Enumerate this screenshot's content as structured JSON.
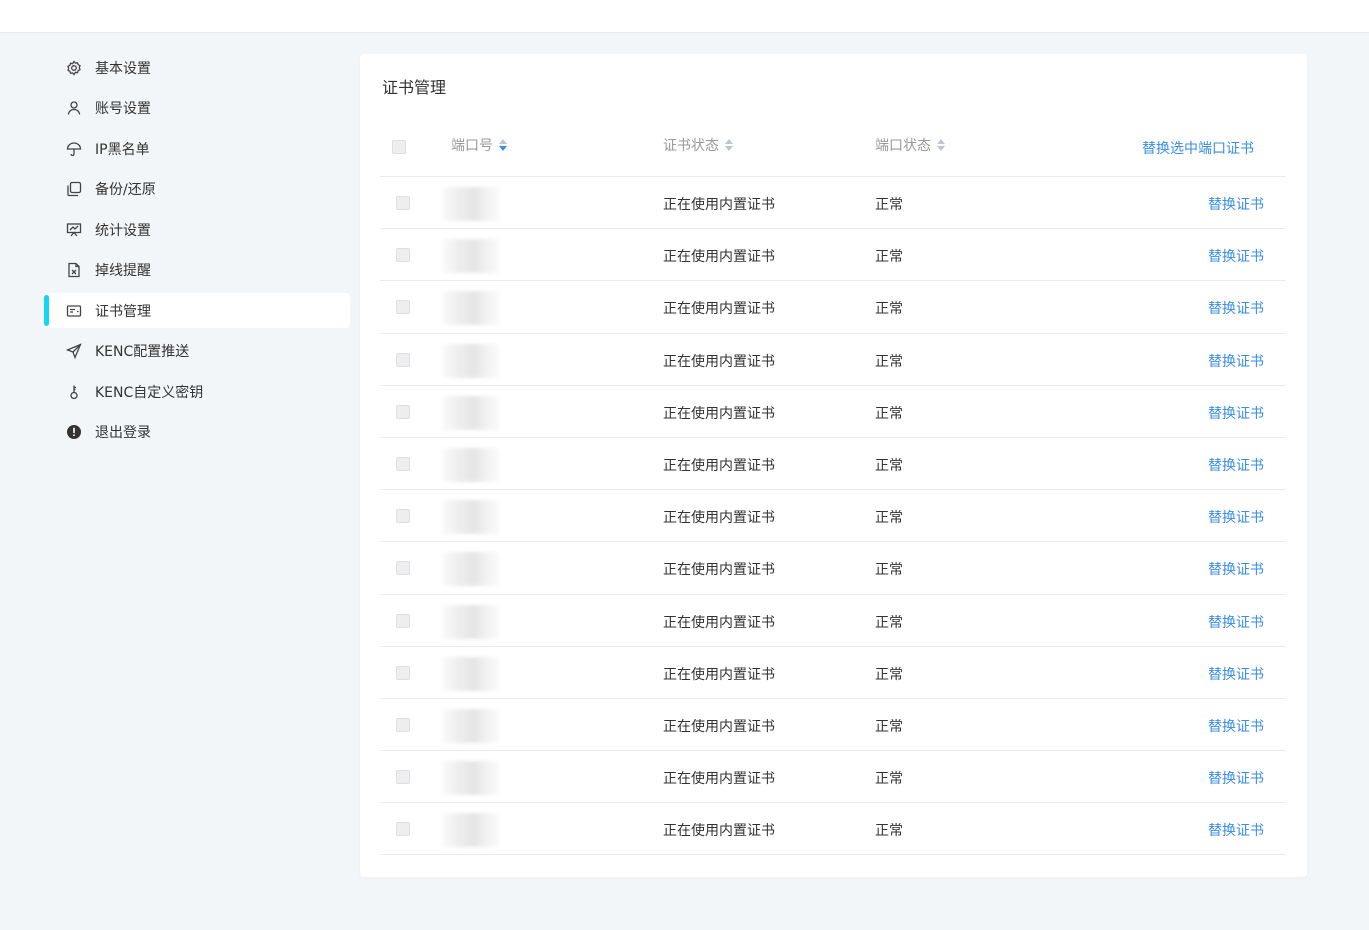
{
  "sidebar": {
    "items": [
      {
        "label": "基本设置",
        "icon": "gear-icon",
        "active": false
      },
      {
        "label": "账号设置",
        "icon": "user-icon",
        "active": false
      },
      {
        "label": "IP黑名单",
        "icon": "umbrella-icon",
        "active": false
      },
      {
        "label": "备份/还原",
        "icon": "copy-icon",
        "active": false
      },
      {
        "label": "统计设置",
        "icon": "presentation-chart-icon",
        "active": false
      },
      {
        "label": "掉线提醒",
        "icon": "file-x-icon",
        "active": false
      },
      {
        "label": "证书管理",
        "icon": "certificate-card-icon",
        "active": true
      },
      {
        "label": "KENC配置推送",
        "icon": "send-icon",
        "active": false
      },
      {
        "label": "KENC自定义密钥",
        "icon": "key-icon",
        "active": false
      },
      {
        "label": "退出登录",
        "icon": "exclamation-circle-icon",
        "active": false
      }
    ],
    "accent_color": "#14d6f0"
  },
  "panel": {
    "title": "证书管理",
    "columns": {
      "port": "端口号",
      "cert_status": "证书状态",
      "port_status": "端口状态"
    },
    "bulk_action": "替换选中端口证书",
    "link_color": "#3a8ee6",
    "rows": [
      {
        "cert_status": "正在使用内置证书",
        "port_status": "正常",
        "action": "替换证书"
      },
      {
        "cert_status": "正在使用内置证书",
        "port_status": "正常",
        "action": "替换证书"
      },
      {
        "cert_status": "正在使用内置证书",
        "port_status": "正常",
        "action": "替换证书"
      },
      {
        "cert_status": "正在使用内置证书",
        "port_status": "正常",
        "action": "替换证书"
      },
      {
        "cert_status": "正在使用内置证书",
        "port_status": "正常",
        "action": "替换证书"
      },
      {
        "cert_status": "正在使用内置证书",
        "port_status": "正常",
        "action": "替换证书"
      },
      {
        "cert_status": "正在使用内置证书",
        "port_status": "正常",
        "action": "替换证书"
      },
      {
        "cert_status": "正在使用内置证书",
        "port_status": "正常",
        "action": "替换证书"
      },
      {
        "cert_status": "正在使用内置证书",
        "port_status": "正常",
        "action": "替换证书"
      },
      {
        "cert_status": "正在使用内置证书",
        "port_status": "正常",
        "action": "替换证书"
      },
      {
        "cert_status": "正在使用内置证书",
        "port_status": "正常",
        "action": "替换证书"
      },
      {
        "cert_status": "正在使用内置证书",
        "port_status": "正常",
        "action": "替换证书"
      },
      {
        "cert_status": "正在使用内置证书",
        "port_status": "正常",
        "action": "替换证书"
      }
    ]
  }
}
